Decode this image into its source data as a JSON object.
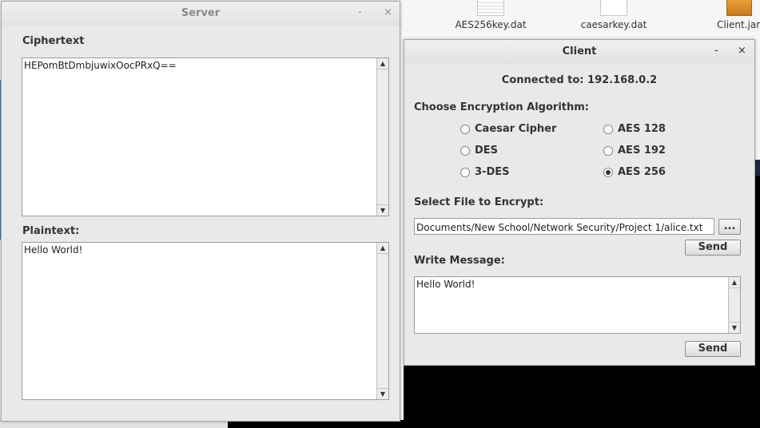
{
  "desktop": {
    "files": [
      {
        "name": "AES256key.dat",
        "icon": "document-icon"
      },
      {
        "name": "caesarkey.dat",
        "icon": "file-icon"
      },
      {
        "name": "Client.jar",
        "icon": "jar-icon"
      }
    ],
    "partial_label": "t"
  },
  "server": {
    "title": "Server",
    "ciphertext_label": "Ciphertext",
    "ciphertext_value": "HEPomBtDmbjuwixOocPRxQ==",
    "plaintext_label": "Plaintext:",
    "plaintext_value": "Hello World!"
  },
  "client": {
    "title": "Client",
    "connected_text": "Connected to: 192.168.0.2",
    "choose_label": "Choose Encryption Algorithm:",
    "algorithms": [
      {
        "label": "Caesar Cipher",
        "selected": false
      },
      {
        "label": "AES 128",
        "selected": false
      },
      {
        "label": "DES",
        "selected": false
      },
      {
        "label": "AES 192",
        "selected": false
      },
      {
        "label": "3-DES",
        "selected": false
      },
      {
        "label": "AES 256",
        "selected": true
      }
    ],
    "select_file_label": "Select File to Encrypt:",
    "file_path": "Documents/New School/Network Security/Project 1/alice.txt",
    "browse_label": "...",
    "send_file_label": "Send",
    "write_label": "Write Message:",
    "message_value": "Hello World!",
    "send_message_label": "Send"
  },
  "window_controls": {
    "minimize": "-",
    "close": "×"
  },
  "scroll_arrows": {
    "up": "▲",
    "down": "▼"
  }
}
